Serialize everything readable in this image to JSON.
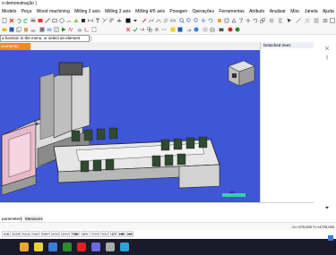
{
  "window": {
    "title": "o demonstração )"
  },
  "menu": {
    "items": [
      "Modelo",
      "Peça",
      "Wood machining",
      "Milling 2 axis",
      "Milling 3 axis",
      "Milling 4/5 axis",
      "Posagen",
      "Operações",
      "Ferramentas",
      "Atributo",
      "Analisar",
      "Misc",
      "Janela",
      "Ajuda"
    ]
  },
  "command": {
    "value": "a function in the menu, or select an element"
  },
  "document": {
    "tab_label": "ocumento"
  },
  "panel": {
    "title": "Detached trees"
  },
  "bottom_tabs": [
    "parameters",
    "Measures"
  ],
  "status": {
    "coords": "X=+270,000  Y=+4725,000"
  },
  "snap_buttons": [
    "IOB",
    "SGR",
    "SCA",
    "SKE",
    "REP",
    "ZOO",
    "ZOV",
    "TSE",
    "BRI",
    "TOS",
    "TOC",
    "CT",
    "HR",
    "HS"
  ],
  "viewport": {
    "scale_label": "1m",
    "background": "#3f56d6"
  },
  "colors": {
    "accent_tab": "#f08c1e",
    "viewport_bg": "#3f56d6"
  }
}
